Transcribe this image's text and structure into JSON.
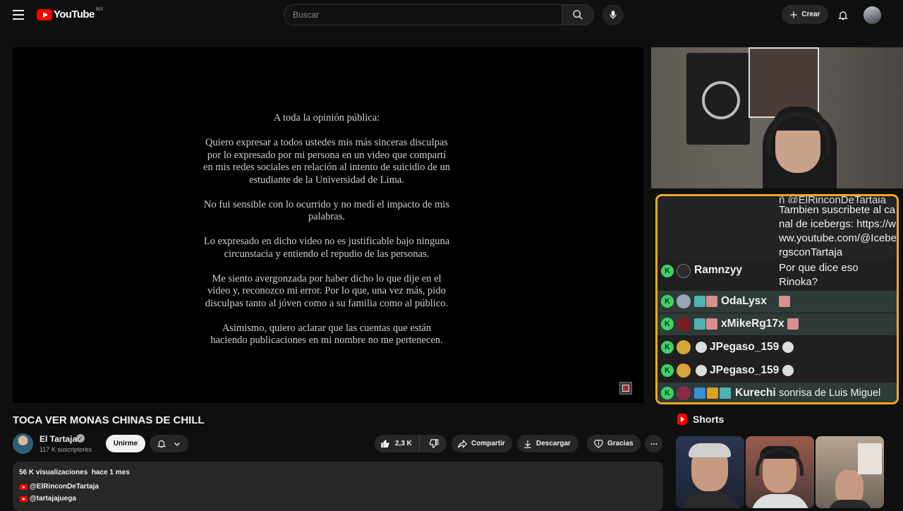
{
  "header": {
    "logo_text": "YouTube",
    "country": "MX",
    "search_placeholder": "Buscar",
    "create_label": "Crear"
  },
  "video": {
    "letter": [
      "A toda la opinión pública:",
      "Quiero expresar a todos ustedes mis más sinceras disculpas por lo expresado por mi persona en un video que compartí en mis redes sociales en relación al intento de suicidio de un estudiante de la Universidad de Lima.",
      "No fui sensible con lo ocurrido y no medí el impacto de mis palabras.",
      "Lo expresado en dicho video no es justificable bajo ninguna circunstacia y entiendo el repudio de las personas.",
      "Me siento avergonzada por haber dicho lo que dije en el video y, reconozco mi error. Por lo que, una vez más, pido disculpas tanto al jóven como a su familia como al público.",
      "Asimismo, quiero aclarar que las cuentas que están haciendo publicaciones en mi nombre no me pertenecen."
    ],
    "title": "TOCA VER MONAS CHINAS DE CHILL"
  },
  "chat": {
    "top_text": "Tambien suscribete al canal de icebergs: https://www.youtube.com/@IcebergsconTartaja",
    "top_text_cut": "ñ @ElRinconDeTartaja",
    "messages": [
      {
        "badge": "K",
        "name": "Ramnzyy",
        "message": "Por que dice eso",
        "message2": "Rinoka?",
        "highlight": false
      },
      {
        "badge": "K",
        "name": "OdaLysx",
        "message": "",
        "highlight": true
      },
      {
        "badge": "K",
        "name": "xMikeRg17x",
        "message": "",
        "highlight": true
      },
      {
        "badge": "K",
        "name": "JPegaso_159",
        "message": "",
        "highlight": false
      },
      {
        "badge": "K",
        "name": "JPegaso_159",
        "message": "",
        "highlight": false
      },
      {
        "badge": "K",
        "name": "Kurechi",
        "message": "sonrisa de Luis Miguel",
        "highlight": true
      }
    ]
  },
  "channel": {
    "name": "El Tartaja",
    "verified": "✓",
    "subscribers": "117 K suscriptores",
    "join_label": "Unirme"
  },
  "actions": {
    "likes": "2,3 K",
    "share": "Compartir",
    "download": "Descargar",
    "thanks": "Gracias"
  },
  "description": {
    "meta": "56 K visualizaciones  hace 1 mes",
    "links": [
      "@ElRinconDeTartaja",
      "@tartajajuega"
    ]
  },
  "shorts": {
    "heading": "Shorts"
  },
  "colors": {
    "brand": "#ff0000",
    "chat_border": "#f0a81c",
    "k_badge": "#3ed26a"
  }
}
